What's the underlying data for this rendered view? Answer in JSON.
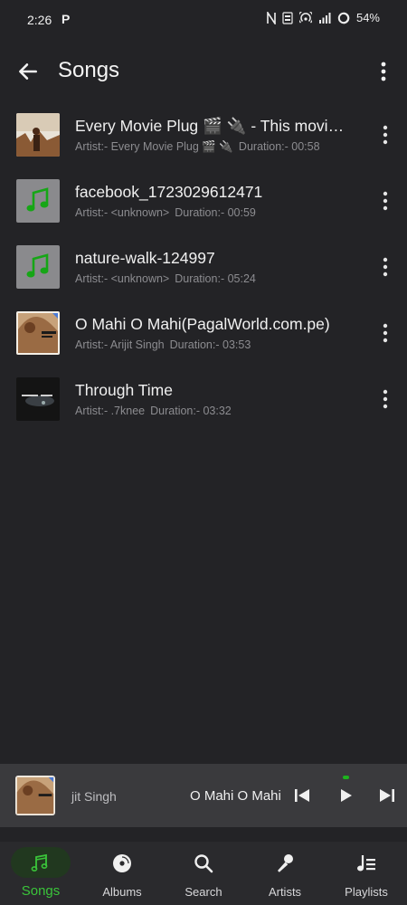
{
  "status_bar": {
    "time": "2:26",
    "app_indicator": "P",
    "battery": "54%"
  },
  "header": {
    "title": "Songs"
  },
  "songs": [
    {
      "title": "Every Movie Plug 🎬 🔌 - This movie is just too good",
      "artist": "Artist:- Every Movie Plug 🎬 🔌",
      "duration": "Duration:- 00:58",
      "thumb": "photo-warm"
    },
    {
      "title": "facebook_1723029612471",
      "artist": "Artist:- <unknown>",
      "duration": "Duration:- 00:59",
      "thumb": "music-note-placeholder"
    },
    {
      "title": "nature-walk-124997",
      "artist": "Artist:- <unknown>",
      "duration": "Duration:- 05:24",
      "thumb": "music-note-placeholder"
    },
    {
      "title": "O Mahi O Mahi(PagalWorld.com.pe)",
      "artist": "Artist:- Arijit Singh",
      "duration": "Duration:- 03:53",
      "thumb": "album-art-omahi"
    },
    {
      "title": "Through Time",
      "artist": "Artist:- .7knee",
      "duration": "Duration:- 03:32",
      "thumb": "album-art-dark"
    }
  ],
  "mini_player": {
    "artist": "jit Singh",
    "title": "O Mahi O Mahi",
    "state": "paused"
  },
  "nav": {
    "songs": "Songs",
    "albums": "Albums",
    "search": "Search",
    "artists": "Artists",
    "playlists": "Playlists",
    "active": "songs"
  },
  "colors": {
    "background": "#232326",
    "accent": "#3ac43a",
    "placeholder": "#8a8a8d",
    "mini_player_bg": "#3a3a3d"
  }
}
